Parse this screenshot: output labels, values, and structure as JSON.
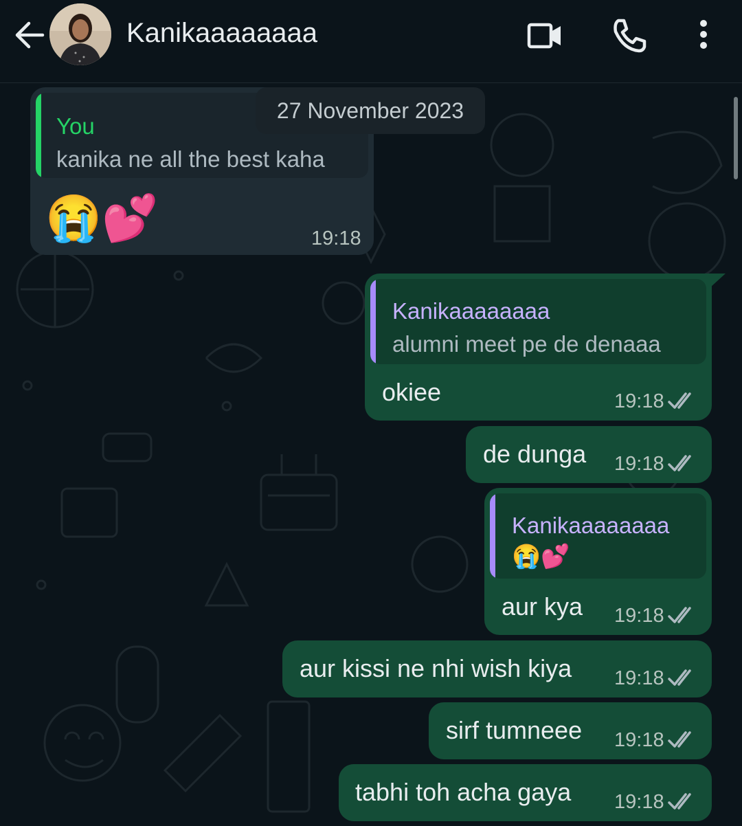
{
  "header": {
    "contact_name": "Kanikaaaaaaaa"
  },
  "date_separator": "27 November 2023",
  "messages": [
    {
      "direction": "incoming",
      "reply_to": {
        "name": "You",
        "text": "kanika ne all the best kaha"
      },
      "text": "😭💕",
      "time": "19:18"
    },
    {
      "direction": "outgoing",
      "reply_to": {
        "name": "Kanikaaaaaaaa",
        "text": "alumni meet pe de denaaa"
      },
      "text": "okiee",
      "time": "19:18",
      "status": "read"
    },
    {
      "direction": "outgoing",
      "text": "de dunga",
      "time": "19:18",
      "status": "read"
    },
    {
      "direction": "outgoing",
      "reply_to": {
        "name": "Kanikaaaaaaaa",
        "text": "😭💕"
      },
      "text": "aur kya",
      "time": "19:18",
      "status": "read"
    },
    {
      "direction": "outgoing",
      "text": "aur kissi ne nhi wish kiya",
      "time": "19:18",
      "status": "read"
    },
    {
      "direction": "outgoing",
      "text": "sirf tumneee",
      "time": "19:18",
      "status": "read"
    },
    {
      "direction": "outgoing",
      "text": "tabhi toh acha gaya",
      "time": "19:18",
      "status": "read"
    }
  ],
  "colors": {
    "background": "#0b141a",
    "incoming_bubble": "#1f2c34",
    "outgoing_bubble": "#144d37",
    "you_quote_accent": "#25d366",
    "contact_quote_accent": "#a78bfa",
    "read_ticks": "#aebac1"
  },
  "icons": {
    "back": "arrow-left-icon",
    "video": "video-call-icon",
    "voice": "phone-icon",
    "menu": "more-vertical-icon"
  }
}
